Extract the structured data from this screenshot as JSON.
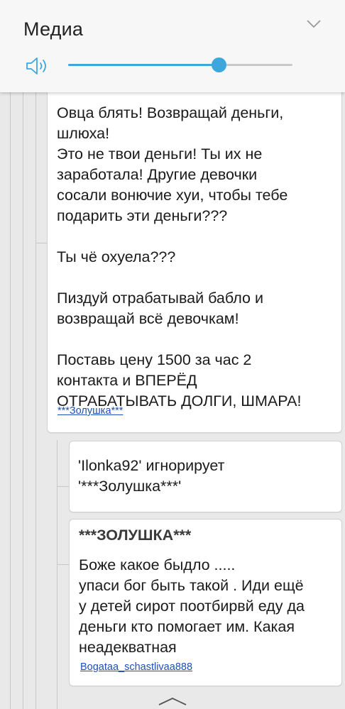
{
  "media": {
    "title": "Медиа",
    "volume_percent": 67,
    "icons": {
      "speaker": "speaker-icon",
      "collapse": "chevron-down-icon"
    },
    "accent_color": "#3da7dd"
  },
  "comments": [
    {
      "lines": [
        "Овца блять! Возвращай деньги,",
        "шлюха!",
        "Это не твои деньги! Ты их не",
        "заработала! Другие девочки",
        "сосали вонючие хуи, чтобы тебе",
        "подарить эти деньги???",
        "",
        "Ты чё охуела???",
        "",
        "Пиздуй отрабатывай бабло и",
        "возвращай всё девочкам!",
        "",
        "Поставь цену 1500 за час 2",
        "контакта и ВПЕРЁД",
        "ОТРАБАТЫВАТЬ ДОЛГИ, ШМАРА!"
      ],
      "author": "***Золушка***"
    },
    {
      "lines": [
        "'Ilonka92' игнорирует",
        "'***Золушка***'"
      ]
    },
    {
      "name": "***ЗОЛУШКА***",
      "lines": [
        "Боже какое быдло .....",
        "упаси бог быть такой . Иди ещё",
        "у детей сирот поотбирвй еду да",
        "деньги кто помогает им. Какая",
        "неадекватная"
      ],
      "author": "Bogataa_schastlivaa888"
    }
  ],
  "navigation": {
    "expand_icon": "chevron-up-icon"
  }
}
